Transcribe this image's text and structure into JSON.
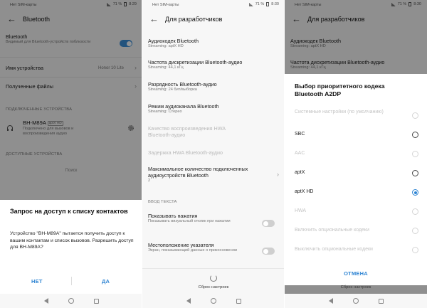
{
  "status": {
    "operator": "Нет SIM-карты",
    "battery": "71 %",
    "times": [
      "8:29",
      "8:30",
      "8:30"
    ]
  },
  "panel1": {
    "title": "Bluetooth",
    "bt_title": "Bluetooth",
    "bt_sub": "Видимый для Bluetooth-устройств поблизости",
    "device_name_label": "Имя устройства",
    "device_name_value": "Honor 10 Lite",
    "received_files": "Полученные файлы",
    "connected_header": "ПОДКЛЮЧЕННЫЕ УСТРОЙСТВА",
    "device": "BH-M89A",
    "device_badge": "aptX HD",
    "device_sub": "Подключено для вызовов и воспроизведения аудио",
    "available_header": "ДОСТУПНЫЕ УСТРОЙСТВА",
    "search": "Поиск",
    "dialog_title": "Запрос на доступ к списку контактов",
    "dialog_body": "Устройство \"BH-M89A\" пытается получить доступ к вашим контактам и список вызовов. Разрешить доступ для BH-M89A?",
    "deny": "НЕТ",
    "allow": "ДА"
  },
  "panel2": {
    "title": "Для разработчиков",
    "items": [
      {
        "title": "Аудиокодек Bluetooth",
        "sub": "Streaming: aptX HD"
      },
      {
        "title": "Частота дискретизации Bluetooth-аудио",
        "sub": "Streaming: 44,1 кГц"
      },
      {
        "title": "Разрядность Bluetooth-аудио",
        "sub": "Streaming: 24 бит/выборка"
      },
      {
        "title": "Режим аудиоканала Bluetooth",
        "sub": "Streaming: Стерео"
      }
    ],
    "hwa_playback": "Качество воспроизведения HWA Bluetooth-аудио",
    "hwa_delay": "Задержка HWA Bluetooth-аудио",
    "max_devices_title": "Максимальное количество подключенных аудиоустройств Bluetooth",
    "max_devices_value": "2",
    "input_header": "ВВОД ТЕКСТА",
    "show_taps_title": "Показывать нажатия",
    "show_taps_sub": "Показывать визуальный отклик при нажатии",
    "pointer_title": "Местоположение указателя",
    "pointer_sub": "Экран, показывающий данные о прикосновении",
    "reset": "Сброс настроек"
  },
  "panel3": {
    "title": "Для разработчиков",
    "bg_items": [
      {
        "title": "Аудиокодек Bluetooth",
        "sub": "Streaming: aptX HD"
      },
      {
        "title": "Частота дискретизации Bluetooth-аудио",
        "sub": "Streaming: 44,1 кГц"
      }
    ],
    "dialog_title": "Выбор приоритетного кодека Bluetooth A2DP",
    "options": [
      {
        "label": "Системные настройки (по умолчанию)",
        "state": "disabled"
      },
      {
        "label": "SBC",
        "state": "enabled"
      },
      {
        "label": "AAC",
        "state": "disabled"
      },
      {
        "label": "aptX",
        "state": "enabled"
      },
      {
        "label": "aptX HD",
        "state": "selected"
      },
      {
        "label": "HWA",
        "state": "disabled"
      },
      {
        "label": "Включить опциональные кодеки",
        "state": "disabled"
      },
      {
        "label": "Выключить опциональные кодеки",
        "state": "disabled"
      }
    ],
    "cancel": "ОТМЕНА",
    "reset": "Сброс настроек"
  },
  "colors": {
    "accent": "#2f85d3",
    "toggle_on": "#3d8fd7"
  }
}
